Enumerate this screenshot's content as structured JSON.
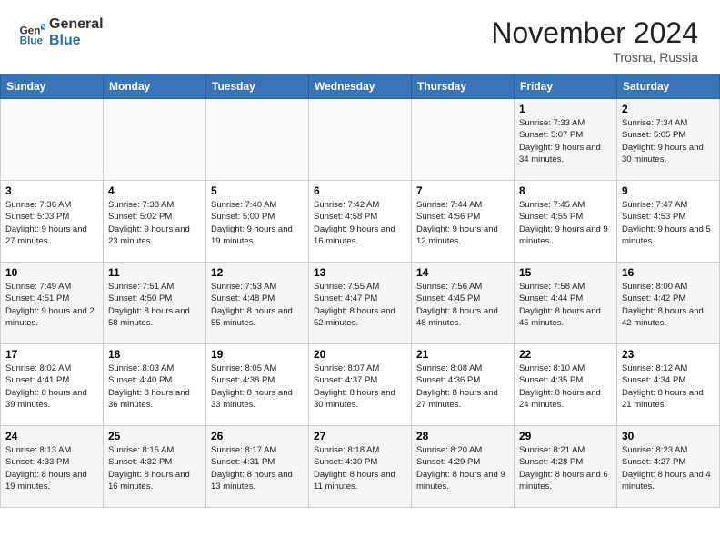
{
  "header": {
    "logo_general": "General",
    "logo_blue": "Blue",
    "title": "November 2024",
    "location": "Trosna, Russia"
  },
  "days_of_week": [
    "Sunday",
    "Monday",
    "Tuesday",
    "Wednesday",
    "Thursday",
    "Friday",
    "Saturday"
  ],
  "weeks": [
    [
      {
        "day": "",
        "empty": true
      },
      {
        "day": "",
        "empty": true
      },
      {
        "day": "",
        "empty": true
      },
      {
        "day": "",
        "empty": true
      },
      {
        "day": "",
        "empty": true
      },
      {
        "day": "1",
        "sunrise": "Sunrise: 7:33 AM",
        "sunset": "Sunset: 5:07 PM",
        "daylight": "Daylight: 9 hours and 34 minutes."
      },
      {
        "day": "2",
        "sunrise": "Sunrise: 7:34 AM",
        "sunset": "Sunset: 5:05 PM",
        "daylight": "Daylight: 9 hours and 30 minutes."
      }
    ],
    [
      {
        "day": "3",
        "sunrise": "Sunrise: 7:36 AM",
        "sunset": "Sunset: 5:03 PM",
        "daylight": "Daylight: 9 hours and 27 minutes."
      },
      {
        "day": "4",
        "sunrise": "Sunrise: 7:38 AM",
        "sunset": "Sunset: 5:02 PM",
        "daylight": "Daylight: 9 hours and 23 minutes."
      },
      {
        "day": "5",
        "sunrise": "Sunrise: 7:40 AM",
        "sunset": "Sunset: 5:00 PM",
        "daylight": "Daylight: 9 hours and 19 minutes."
      },
      {
        "day": "6",
        "sunrise": "Sunrise: 7:42 AM",
        "sunset": "Sunset: 4:58 PM",
        "daylight": "Daylight: 9 hours and 16 minutes."
      },
      {
        "day": "7",
        "sunrise": "Sunrise: 7:44 AM",
        "sunset": "Sunset: 4:56 PM",
        "daylight": "Daylight: 9 hours and 12 minutes."
      },
      {
        "day": "8",
        "sunrise": "Sunrise: 7:45 AM",
        "sunset": "Sunset: 4:55 PM",
        "daylight": "Daylight: 9 hours and 9 minutes."
      },
      {
        "day": "9",
        "sunrise": "Sunrise: 7:47 AM",
        "sunset": "Sunset: 4:53 PM",
        "daylight": "Daylight: 9 hours and 5 minutes."
      }
    ],
    [
      {
        "day": "10",
        "sunrise": "Sunrise: 7:49 AM",
        "sunset": "Sunset: 4:51 PM",
        "daylight": "Daylight: 9 hours and 2 minutes."
      },
      {
        "day": "11",
        "sunrise": "Sunrise: 7:51 AM",
        "sunset": "Sunset: 4:50 PM",
        "daylight": "Daylight: 8 hours and 58 minutes."
      },
      {
        "day": "12",
        "sunrise": "Sunrise: 7:53 AM",
        "sunset": "Sunset: 4:48 PM",
        "daylight": "Daylight: 8 hours and 55 minutes."
      },
      {
        "day": "13",
        "sunrise": "Sunrise: 7:55 AM",
        "sunset": "Sunset: 4:47 PM",
        "daylight": "Daylight: 8 hours and 52 minutes."
      },
      {
        "day": "14",
        "sunrise": "Sunrise: 7:56 AM",
        "sunset": "Sunset: 4:45 PM",
        "daylight": "Daylight: 8 hours and 48 minutes."
      },
      {
        "day": "15",
        "sunrise": "Sunrise: 7:58 AM",
        "sunset": "Sunset: 4:44 PM",
        "daylight": "Daylight: 8 hours and 45 minutes."
      },
      {
        "day": "16",
        "sunrise": "Sunrise: 8:00 AM",
        "sunset": "Sunset: 4:42 PM",
        "daylight": "Daylight: 8 hours and 42 minutes."
      }
    ],
    [
      {
        "day": "17",
        "sunrise": "Sunrise: 8:02 AM",
        "sunset": "Sunset: 4:41 PM",
        "daylight": "Daylight: 8 hours and 39 minutes."
      },
      {
        "day": "18",
        "sunrise": "Sunrise: 8:03 AM",
        "sunset": "Sunset: 4:40 PM",
        "daylight": "Daylight: 8 hours and 36 minutes."
      },
      {
        "day": "19",
        "sunrise": "Sunrise: 8:05 AM",
        "sunset": "Sunset: 4:38 PM",
        "daylight": "Daylight: 8 hours and 33 minutes."
      },
      {
        "day": "20",
        "sunrise": "Sunrise: 8:07 AM",
        "sunset": "Sunset: 4:37 PM",
        "daylight": "Daylight: 8 hours and 30 minutes."
      },
      {
        "day": "21",
        "sunrise": "Sunrise: 8:08 AM",
        "sunset": "Sunset: 4:36 PM",
        "daylight": "Daylight: 8 hours and 27 minutes."
      },
      {
        "day": "22",
        "sunrise": "Sunrise: 8:10 AM",
        "sunset": "Sunset: 4:35 PM",
        "daylight": "Daylight: 8 hours and 24 minutes."
      },
      {
        "day": "23",
        "sunrise": "Sunrise: 8:12 AM",
        "sunset": "Sunset: 4:34 PM",
        "daylight": "Daylight: 8 hours and 21 minutes."
      }
    ],
    [
      {
        "day": "24",
        "sunrise": "Sunrise: 8:13 AM",
        "sunset": "Sunset: 4:33 PM",
        "daylight": "Daylight: 8 hours and 19 minutes."
      },
      {
        "day": "25",
        "sunrise": "Sunrise: 8:15 AM",
        "sunset": "Sunset: 4:32 PM",
        "daylight": "Daylight: 8 hours and 16 minutes."
      },
      {
        "day": "26",
        "sunrise": "Sunrise: 8:17 AM",
        "sunset": "Sunset: 4:31 PM",
        "daylight": "Daylight: 8 hours and 13 minutes."
      },
      {
        "day": "27",
        "sunrise": "Sunrise: 8:18 AM",
        "sunset": "Sunset: 4:30 PM",
        "daylight": "Daylight: 8 hours and 11 minutes."
      },
      {
        "day": "28",
        "sunrise": "Sunrise: 8:20 AM",
        "sunset": "Sunset: 4:29 PM",
        "daylight": "Daylight: 8 hours and 9 minutes."
      },
      {
        "day": "29",
        "sunrise": "Sunrise: 8:21 AM",
        "sunset": "Sunset: 4:28 PM",
        "daylight": "Daylight: 8 hours and 6 minutes."
      },
      {
        "day": "30",
        "sunrise": "Sunrise: 8:23 AM",
        "sunset": "Sunset: 4:27 PM",
        "daylight": "Daylight: 8 hours and 4 minutes."
      }
    ]
  ]
}
